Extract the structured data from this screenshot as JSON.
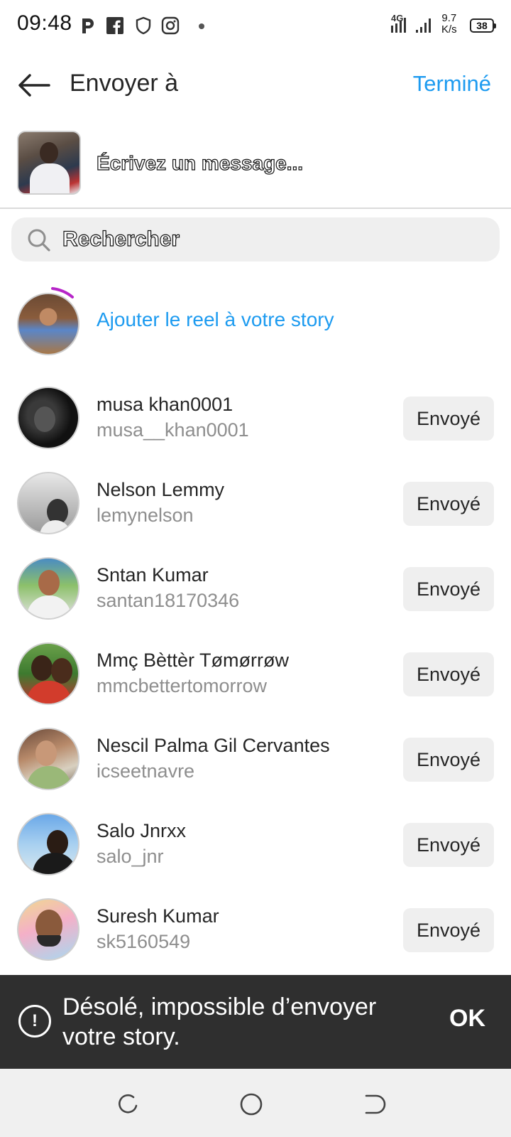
{
  "status_bar": {
    "time": "09:48",
    "network": "4G",
    "speed_value": "9.7",
    "speed_unit": "K/s",
    "battery": "38"
  },
  "header": {
    "title": "Envoyer à",
    "done_label": "Terminé"
  },
  "message": {
    "placeholder": "Écrivez un message..."
  },
  "search": {
    "placeholder": "Rechercher"
  },
  "story": {
    "label": "Ajouter le reel à votre story"
  },
  "contacts": [
    {
      "name": "musa khan0001",
      "handle": "musa__khan0001",
      "button": "Envoyé"
    },
    {
      "name": "Nelson Lemmy",
      "handle": "lemynelson",
      "button": "Envoyé"
    },
    {
      "name": "Sntan Kumar",
      "handle": "santan18170346",
      "button": "Envoyé"
    },
    {
      "name": "Mmç Bèttèr Tømørrøw",
      "handle": "mmcbettertomorrow",
      "button": "Envoyé"
    },
    {
      "name": "Nescil Palma Gil Cervantes",
      "handle": "icseetnavre",
      "button": "Envoyé"
    },
    {
      "name": "Salo Jnrxx",
      "handle": "salo_jnr",
      "button": "Envoyé"
    },
    {
      "name": "Suresh Kumar",
      "handle": "sk5160549",
      "button": "Envoyé"
    }
  ],
  "toast": {
    "message": "Désolé, impossible d’envoyer votre story.",
    "action": "OK"
  },
  "colors": {
    "accent": "#1d9bf0",
    "toast_bg": "#2f2f2f",
    "button_bg": "#efefef"
  }
}
